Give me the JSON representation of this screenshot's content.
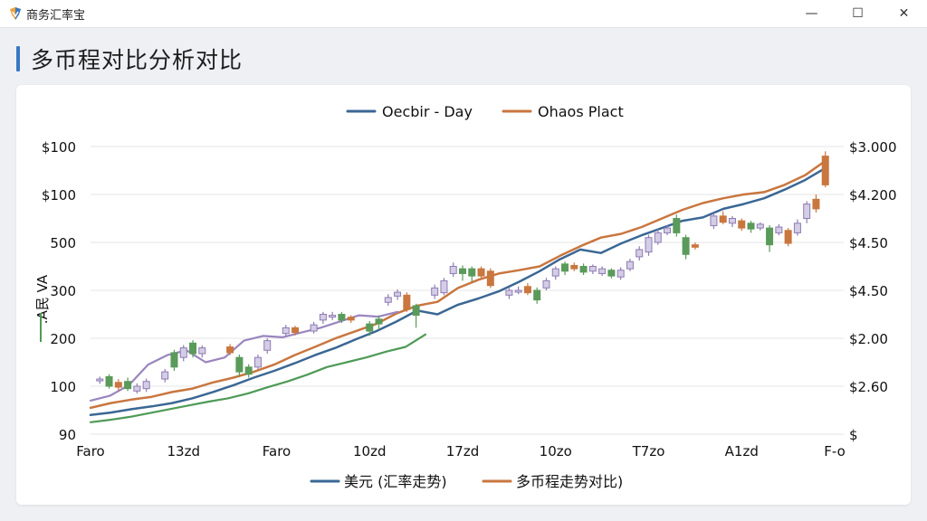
{
  "window": {
    "app_title": "商务汇率宝",
    "controls": {
      "minimize": "—",
      "maximize": "☐",
      "close": "✕"
    }
  },
  "page": {
    "heading": "多币程对比分析对比"
  },
  "colors": {
    "usd": "#3a6794",
    "multi": "#c9763f",
    "green_line": "#4e9a57",
    "purple_line": "#9a85bf",
    "candle_up": "#d4cde6",
    "candle_up_border": "#8e7bb3",
    "candle_green": "#5a9a5a",
    "candle_orange": "#c9763f",
    "grid": "#e6e6e6"
  },
  "chart_data": {
    "type": "line",
    "title": "",
    "legend_top": [
      "Oecbir  - Day",
      "Ohaos Plact"
    ],
    "legend_bottom": [
      "美元 (汇率走势)",
      "多币程走势对比)"
    ],
    "legend_placement": "top and bottom",
    "x_tick_labels": [
      "Faro",
      "13zd",
      "Faro",
      "10zd",
      "17zd",
      "10zo",
      "T7zo",
      "A1zd",
      "F-o"
    ],
    "y_left_label": ".A民 VA",
    "y_left_ticks": [
      "$100",
      "$100",
      "500",
      "300",
      "200",
      "100",
      "90"
    ],
    "y_right_ticks": [
      "$3.000",
      "$4.200",
      "$4.50",
      "$4.50",
      "$2.00",
      "$2.60",
      "$"
    ],
    "y_range": [
      0,
      600
    ],
    "grid": "horizontal",
    "series": [
      {
        "name": "美元 (汇率走势)",
        "role": "usd",
        "values": [
          40,
          45,
          52,
          58,
          65,
          75,
          88,
          102,
          118,
          132,
          148,
          165,
          180,
          198,
          215,
          235,
          258,
          250,
          270,
          283,
          298,
          318,
          340,
          365,
          385,
          378,
          398,
          415,
          430,
          445,
          452,
          470,
          480,
          492,
          510,
          530,
          555
        ]
      },
      {
        "name": "多币程走势对比)",
        "role": "multi",
        "values": [
          55,
          65,
          72,
          78,
          88,
          95,
          108,
          118,
          130,
          145,
          165,
          182,
          200,
          215,
          230,
          252,
          268,
          276,
          305,
          322,
          335,
          342,
          350,
          372,
          392,
          410,
          418,
          432,
          450,
          468,
          482,
          492,
          500,
          505,
          520,
          540,
          570
        ]
      },
      {
        "role": "green_line",
        "values": [
          25,
          30,
          36,
          44,
          52,
          60,
          68,
          75,
          85,
          98,
          110,
          124,
          140,
          150,
          160,
          172,
          182,
          208
        ]
      },
      {
        "role": "purple_line",
        "values": [
          70,
          80,
          102,
          145,
          165,
          175,
          150,
          160,
          195,
          205,
          202,
          212,
          222,
          235,
          248,
          245,
          255
        ]
      }
    ],
    "candles": [
      {
        "x": 0.5,
        "o": 115,
        "c": 112,
        "h": 120,
        "l": 105,
        "k": "up"
      },
      {
        "x": 1.0,
        "o": 100,
        "c": 120,
        "h": 125,
        "l": 95,
        "k": "green"
      },
      {
        "x": 1.5,
        "o": 108,
        "c": 98,
        "h": 115,
        "l": 90,
        "k": "orange"
      },
      {
        "x": 2.0,
        "o": 95,
        "c": 110,
        "h": 118,
        "l": 90,
        "k": "green"
      },
      {
        "x": 2.5,
        "o": 90,
        "c": 100,
        "h": 106,
        "l": 85,
        "k": "up"
      },
      {
        "x": 3.0,
        "o": 95,
        "c": 110,
        "h": 116,
        "l": 88,
        "k": "up"
      },
      {
        "x": 4.0,
        "o": 115,
        "c": 130,
        "h": 136,
        "l": 108,
        "k": "up"
      },
      {
        "x": 4.5,
        "o": 140,
        "c": 170,
        "h": 176,
        "l": 132,
        "k": "green"
      },
      {
        "x": 5.0,
        "o": 160,
        "c": 180,
        "h": 186,
        "l": 152,
        "k": "up"
      },
      {
        "x": 5.5,
        "o": 190,
        "c": 168,
        "h": 196,
        "l": 160,
        "k": "green"
      },
      {
        "x": 6.0,
        "o": 168,
        "c": 180,
        "h": 185,
        "l": 160,
        "k": "up"
      },
      {
        "x": 7.5,
        "o": 170,
        "c": 182,
        "h": 188,
        "l": 165,
        "k": "orange"
      },
      {
        "x": 8.0,
        "o": 130,
        "c": 160,
        "h": 166,
        "l": 120,
        "k": "green"
      },
      {
        "x": 8.5,
        "o": 125,
        "c": 140,
        "h": 146,
        "l": 118,
        "k": "green"
      },
      {
        "x": 9.0,
        "o": 140,
        "c": 160,
        "h": 166,
        "l": 135,
        "k": "up"
      },
      {
        "x": 9.5,
        "o": 175,
        "c": 195,
        "h": 200,
        "l": 168,
        "k": "up"
      },
      {
        "x": 10.5,
        "o": 210,
        "c": 222,
        "h": 228,
        "l": 205,
        "k": "up"
      },
      {
        "x": 11.0,
        "o": 212,
        "c": 222,
        "h": 226,
        "l": 206,
        "k": "orange"
      },
      {
        "x": 12.0,
        "o": 215,
        "c": 228,
        "h": 234,
        "l": 210,
        "k": "up"
      },
      {
        "x": 12.5,
        "o": 238,
        "c": 250,
        "h": 255,
        "l": 230,
        "k": "up"
      },
      {
        "x": 13.0,
        "o": 245,
        "c": 248,
        "h": 255,
        "l": 238,
        "k": "up"
      },
      {
        "x": 13.5,
        "o": 250,
        "c": 238,
        "h": 255,
        "l": 232,
        "k": "green"
      },
      {
        "x": 14.0,
        "o": 238,
        "c": 244,
        "h": 248,
        "l": 232,
        "k": "orange"
      },
      {
        "x": 15.0,
        "o": 215,
        "c": 230,
        "h": 236,
        "l": 205,
        "k": "green"
      },
      {
        "x": 15.5,
        "o": 240,
        "c": 230,
        "h": 248,
        "l": 218,
        "k": "green"
      },
      {
        "x": 16.0,
        "o": 275,
        "c": 285,
        "h": 292,
        "l": 268,
        "k": "up"
      },
      {
        "x": 16.5,
        "o": 288,
        "c": 296,
        "h": 302,
        "l": 280,
        "k": "up"
      },
      {
        "x": 17.0,
        "o": 290,
        "c": 260,
        "h": 296,
        "l": 255,
        "k": "orange"
      },
      {
        "x": 17.5,
        "o": 268,
        "c": 248,
        "h": 272,
        "l": 222,
        "k": "green"
      },
      {
        "x": 18.5,
        "o": 290,
        "c": 305,
        "h": 312,
        "l": 282,
        "k": "up"
      },
      {
        "x": 19.0,
        "o": 295,
        "c": 320,
        "h": 326,
        "l": 290,
        "k": "up"
      },
      {
        "x": 19.5,
        "o": 335,
        "c": 350,
        "h": 358,
        "l": 328,
        "k": "up"
      },
      {
        "x": 20.0,
        "o": 345,
        "c": 335,
        "h": 352,
        "l": 320,
        "k": "green"
      },
      {
        "x": 20.5,
        "o": 345,
        "c": 330,
        "h": 350,
        "l": 318,
        "k": "green"
      },
      {
        "x": 21.0,
        "o": 330,
        "c": 345,
        "h": 350,
        "l": 325,
        "k": "orange"
      },
      {
        "x": 21.5,
        "o": 340,
        "c": 310,
        "h": 346,
        "l": 305,
        "k": "orange"
      },
      {
        "x": 22.5,
        "o": 290,
        "c": 300,
        "h": 305,
        "l": 282,
        "k": "up"
      },
      {
        "x": 23.0,
        "o": 300,
        "c": 298,
        "h": 308,
        "l": 292,
        "k": "up"
      },
      {
        "x": 23.5,
        "o": 295,
        "c": 308,
        "h": 315,
        "l": 290,
        "k": "orange"
      },
      {
        "x": 24.0,
        "o": 300,
        "c": 280,
        "h": 306,
        "l": 272,
        "k": "green"
      },
      {
        "x": 24.5,
        "o": 305,
        "c": 320,
        "h": 326,
        "l": 300,
        "k": "up"
      },
      {
        "x": 25.0,
        "o": 330,
        "c": 345,
        "h": 350,
        "l": 322,
        "k": "up"
      },
      {
        "x": 25.5,
        "o": 355,
        "c": 340,
        "h": 360,
        "l": 332,
        "k": "green"
      },
      {
        "x": 26.0,
        "o": 345,
        "c": 352,
        "h": 358,
        "l": 340,
        "k": "orange"
      },
      {
        "x": 26.5,
        "o": 350,
        "c": 338,
        "h": 356,
        "l": 332,
        "k": "green"
      },
      {
        "x": 27.0,
        "o": 340,
        "c": 350,
        "h": 354,
        "l": 334,
        "k": "up"
      },
      {
        "x": 27.5,
        "o": 345,
        "c": 335,
        "h": 350,
        "l": 330,
        "k": "up"
      },
      {
        "x": 28.0,
        "o": 342,
        "c": 330,
        "h": 346,
        "l": 325,
        "k": "green"
      },
      {
        "x": 28.5,
        "o": 328,
        "c": 342,
        "h": 348,
        "l": 322,
        "k": "up"
      },
      {
        "x": 29.0,
        "o": 345,
        "c": 360,
        "h": 366,
        "l": 340,
        "k": "up"
      },
      {
        "x": 29.5,
        "o": 370,
        "c": 385,
        "h": 392,
        "l": 362,
        "k": "up"
      },
      {
        "x": 30.0,
        "o": 380,
        "c": 410,
        "h": 416,
        "l": 372,
        "k": "up"
      },
      {
        "x": 30.5,
        "o": 400,
        "c": 420,
        "h": 428,
        "l": 395,
        "k": "up"
      },
      {
        "x": 31.0,
        "o": 420,
        "c": 430,
        "h": 436,
        "l": 415,
        "k": "up"
      },
      {
        "x": 31.5,
        "o": 450,
        "c": 420,
        "h": 458,
        "l": 412,
        "k": "green"
      },
      {
        "x": 32.0,
        "o": 410,
        "c": 375,
        "h": 416,
        "l": 365,
        "k": "green"
      },
      {
        "x": 32.5,
        "o": 390,
        "c": 395,
        "h": 400,
        "l": 385,
        "k": "orange"
      },
      {
        "x": 33.5,
        "o": 435,
        "c": 455,
        "h": 462,
        "l": 428,
        "k": "up"
      },
      {
        "x": 34.0,
        "o": 455,
        "c": 442,
        "h": 465,
        "l": 438,
        "k": "orange"
      },
      {
        "x": 34.5,
        "o": 440,
        "c": 450,
        "h": 455,
        "l": 432,
        "k": "up"
      },
      {
        "x": 35.0,
        "o": 445,
        "c": 430,
        "h": 450,
        "l": 424,
        "k": "orange"
      },
      {
        "x": 35.5,
        "o": 440,
        "c": 428,
        "h": 445,
        "l": 420,
        "k": "green"
      },
      {
        "x": 36.0,
        "o": 430,
        "c": 438,
        "h": 442,
        "l": 425,
        "k": "up"
      },
      {
        "x": 36.5,
        "o": 430,
        "c": 395,
        "h": 436,
        "l": 380,
        "k": "green"
      },
      {
        "x": 37.0,
        "o": 420,
        "c": 432,
        "h": 438,
        "l": 415,
        "k": "up"
      },
      {
        "x": 37.5,
        "o": 425,
        "c": 398,
        "h": 430,
        "l": 392,
        "k": "orange"
      },
      {
        "x": 38.0,
        "o": 420,
        "c": 440,
        "h": 448,
        "l": 414,
        "k": "up"
      },
      {
        "x": 38.5,
        "o": 450,
        "c": 480,
        "h": 486,
        "l": 440,
        "k": "up"
      },
      {
        "x": 39.0,
        "o": 470,
        "c": 490,
        "h": 500,
        "l": 462,
        "k": "orange"
      },
      {
        "x": 39.5,
        "o": 520,
        "c": 580,
        "h": 590,
        "l": 515,
        "k": "orange"
      }
    ]
  }
}
